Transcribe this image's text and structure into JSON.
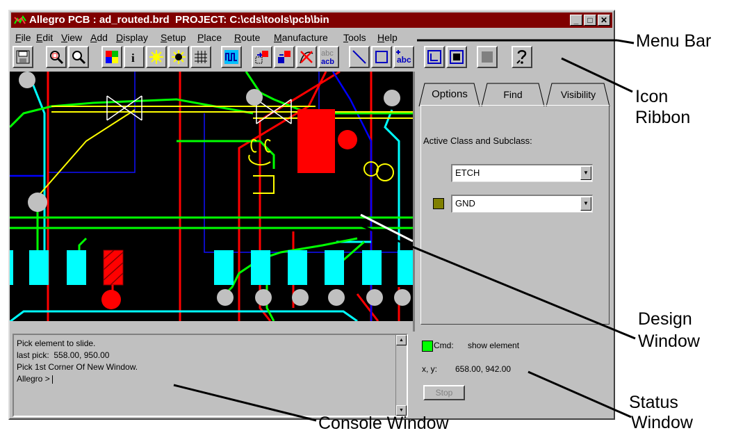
{
  "window": {
    "title": "Allegro PCB : ad_routed.brd  PROJECT: C:\\cds\\tools\\pcb\\bin",
    "controls": [
      "_",
      "□",
      "✕"
    ]
  },
  "menu": [
    "File",
    "Edit",
    "View",
    "Add",
    "Display",
    "Setup",
    "Place",
    "Route",
    "Manufacture",
    "Tools",
    "Help"
  ],
  "toolbar": {
    "abc_acb_label": [
      "abc",
      "acb"
    ],
    "add_text_label": "abc",
    "icons": [
      "save-icon",
      "zoom-fit-icon",
      "zoom-window-icon",
      "color-icon",
      "info-icon",
      "highlight-icon",
      "dehighlight-icon",
      "grid-icon",
      "connect-icon",
      "move-icon",
      "copy-icon",
      "delete-icon",
      "text-edit-icon",
      "add-line-icon",
      "add-rect-icon",
      "add-text-icon",
      "route-icon",
      "shape-icon",
      "shape-fill-icon",
      "help-icon"
    ]
  },
  "panel": {
    "tabs": [
      "Options",
      "Find",
      "Visibility"
    ],
    "active_tab": "Options",
    "active_label": "Active Class and Subclass:",
    "class_value": "ETCH",
    "subclass_value": "GND",
    "subclass_color": "#808000"
  },
  "console": {
    "lines": [
      "Pick element to slide.",
      "last pick:  558.00, 950.00",
      "Pick 1st Corner Of New Window.",
      "Allegro > "
    ]
  },
  "status": {
    "cmd_label": "Cmd:",
    "cmd_value": "show element",
    "xy_label": "x, y:",
    "xy_value": "658.00, 942.00",
    "stop_label": "Stop",
    "indicator_color": "#00ff00"
  },
  "annotations": {
    "menu_bar": "Menu Bar",
    "icon_ribbon_1": "Icon",
    "icon_ribbon_2": "Ribbon",
    "design_window_1": "Design",
    "design_window_2": "Window",
    "status_window_1": "Status",
    "status_window_2": "Window",
    "console_window": "Console Window"
  }
}
